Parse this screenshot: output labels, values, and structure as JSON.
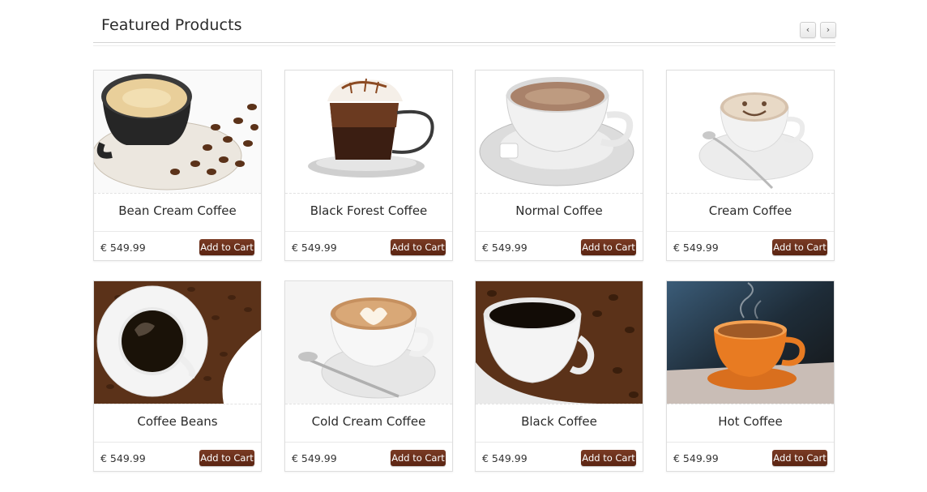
{
  "section": {
    "title": "Featured Products",
    "prev_icon": "‹",
    "next_icon": "›"
  },
  "products": [
    {
      "name": "Bean Cream Coffee",
      "price": "€ 549.99",
      "cart_label": "Add to Cart"
    },
    {
      "name": "Black Forest Coffee",
      "price": "€ 549.99",
      "cart_label": "Add to Cart"
    },
    {
      "name": "Normal Coffee",
      "price": "€ 549.99",
      "cart_label": "Add to Cart"
    },
    {
      "name": "Cream Coffee",
      "price": "€ 549.99",
      "cart_label": "Add to Cart"
    },
    {
      "name": "Coffee Beans",
      "price": "€ 549.99",
      "cart_label": "Add to Cart"
    },
    {
      "name": "Cold Cream Coffee",
      "price": "€ 549.99",
      "cart_label": "Add to Cart"
    },
    {
      "name": "Black Coffee",
      "price": "€ 549.99",
      "cart_label": "Add to Cart"
    },
    {
      "name": "Hot Coffee",
      "price": "€ 549.99",
      "cart_label": "Add to Cart"
    }
  ],
  "colors": {
    "button": "#6a2e1a",
    "coffee_bean": "#5b3219",
    "crema": "#d8b58a"
  }
}
